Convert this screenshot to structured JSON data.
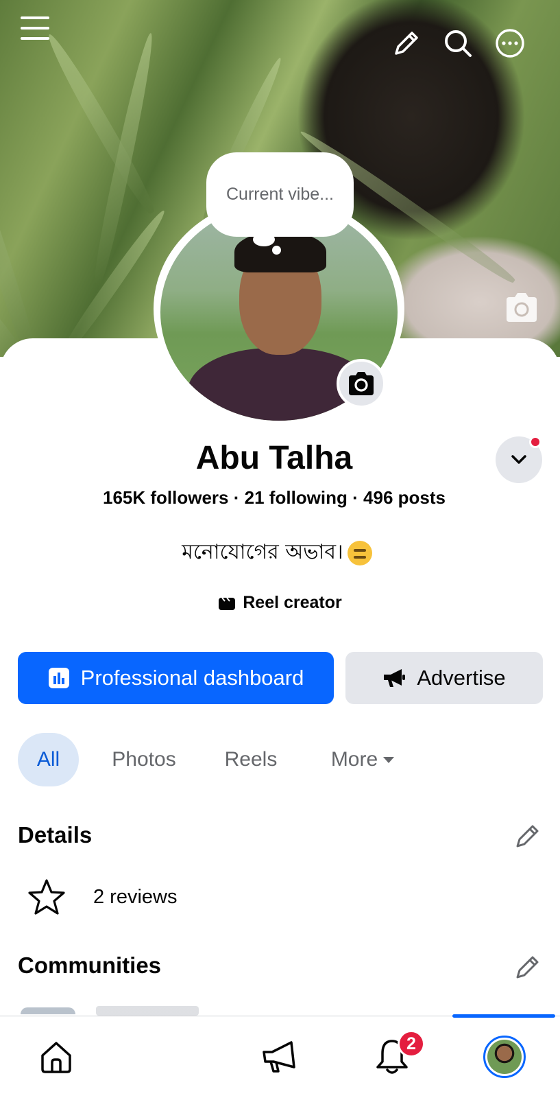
{
  "profile": {
    "bubble_text": "Current vibe...",
    "name": "Abu Talha",
    "followers": "165K followers",
    "following": "21 following",
    "posts": "496 posts",
    "separator": "·",
    "bio": "মনোযোগের অভাব।",
    "category": "Reel creator"
  },
  "actions": {
    "professional_dashboard": "Professional dashboard",
    "advertise": "Advertise"
  },
  "tabs": [
    "All",
    "Photos",
    "Reels",
    "More"
  ],
  "sections": {
    "details_title": "Details",
    "reviews": "2 reviews",
    "communities_title": "Communities"
  },
  "nav": {
    "notifications_badge": "2",
    "items": [
      "home-icon",
      "megaphone-icon",
      "bell-icon",
      "profile-avatar"
    ]
  },
  "colors": {
    "primary": "#0866ff",
    "badge": "#e41e3f",
    "muted_text": "#65676b",
    "secondary_button": "#e4e6eb"
  }
}
